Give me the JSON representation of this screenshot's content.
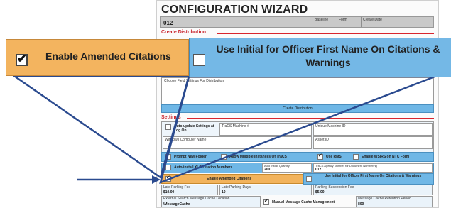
{
  "wizard": {
    "title": "CONFIGURATION WIZARD",
    "header_id": "012",
    "header_cols": [
      "Baseline",
      "Form",
      "Create Date"
    ],
    "create_distribution_head": "Create Distribution",
    "choose_note": "Choose Field Settings For Distribution",
    "create_distribution_button": "Create Distribution",
    "settings_head": "Settings",
    "auto_update_label": "Auto-update Settings at Log On",
    "tracs_machine_label": "TraCS Machine #",
    "unique_id_label": "Unique Machine ID",
    "windows_name_label": "Windows Computer Name",
    "asset_id_label": "Asset ID",
    "options_row1": [
      {
        "label": "Prompt New Folder",
        "checked": false
      },
      {
        "label": "Allow Multiple Instances Of TraCS",
        "checked": false
      },
      {
        "label": "Use RMS",
        "checked": true
      },
      {
        "label": "Enable WSIRS on NTC Form",
        "checked": false
      }
    ],
    "auto_install_label": "Auto-install XLO Citation Numbers",
    "auto_install_qty_label": "Auto Install Quantity",
    "auto_install_qty_value": "200",
    "tracs_agency_label": "TraCS Agency Number for Document Numbering",
    "tracs_agency_value": "012",
    "enable_amended_small": "Enable Amended Citations",
    "use_initial_small": "Use Initial for Officer First Name On Citations & Warnings",
    "late_parking_fee_label": "Late Parking Fee",
    "late_parking_fee_value": "$10.00",
    "late_parking_days_label": "Late Parking Days",
    "late_parking_days_value": "10",
    "parking_suspension_label": "Parking Suspension Fee",
    "parking_suspension_value": "$5.00",
    "external_search_label": "External Search Message Cache Location",
    "external_search_value": "\\MessageCache",
    "manual_cache_label": "Manual Message Cache Management",
    "cache_retention_label": "Message Cache Retention Period",
    "cache_retention_value": "800"
  },
  "callout": {
    "enable_amended": {
      "label": "Enable Amended Citations",
      "checked": true
    },
    "use_initial": {
      "label": "Use Initial for Officer First Name On Citations & Warnings",
      "checked": false
    }
  },
  "colors": {
    "orange": "#f3b45f",
    "blue": "#74b8e6",
    "connector": "#2a4a8f",
    "accent_red": "#d8262e"
  }
}
